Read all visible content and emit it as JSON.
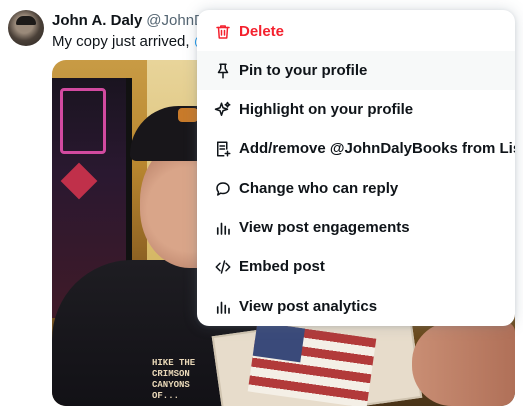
{
  "tweet": {
    "author_name": "John A. Daly",
    "author_handle": "@JohnDaly",
    "text_prefix": "My copy just arrived, ",
    "text_mention": "@N",
    "shirt_print": "HIKE THE\nCRIMSON\nCANYONS\nOF..."
  },
  "menu": {
    "items": [
      {
        "label": "Delete",
        "icon": "trash-icon",
        "color": "#f4212e"
      },
      {
        "label": "Pin to your profile",
        "icon": "pin-icon"
      },
      {
        "label": "Highlight on your profile",
        "icon": "sparkle-icon"
      },
      {
        "label": "Add/remove @JohnDalyBooks from Lists",
        "icon": "list-add-icon"
      },
      {
        "label": "Change who can reply",
        "icon": "reply-bubble-icon"
      },
      {
        "label": "View post engagements",
        "icon": "bar-chart-icon"
      },
      {
        "label": "Embed post",
        "icon": "code-icon"
      },
      {
        "label": "View post analytics",
        "icon": "analytics-icon"
      }
    ]
  },
  "colors": {
    "danger": "#f4212e",
    "mention": "#1d9bf0",
    "text": "#0f1419",
    "secondary": "#536471"
  }
}
